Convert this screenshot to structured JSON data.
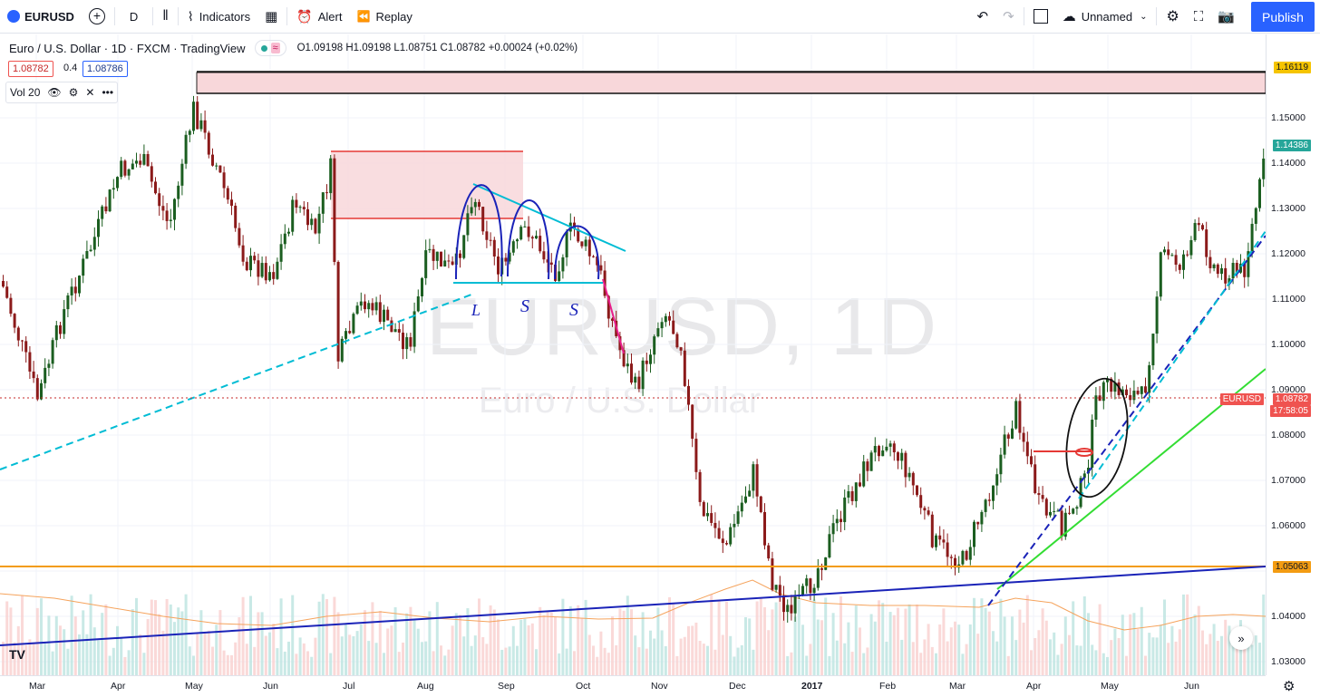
{
  "toolbar": {
    "symbol": "EURUSD",
    "interval": "D",
    "indicators_label": "Indicators",
    "alert_label": "Alert",
    "replay_label": "Replay",
    "layout_name": "Unnamed",
    "publish_label": "Publish"
  },
  "legend": {
    "title": "Euro / U.S. Dollar · 1D · FXCM · TradingView",
    "ohlc": "O1.09198 H1.09198 L1.08751 C1.08782 +0.00024 (+0.02%)",
    "bid": "1.08782",
    "spread": "0.4",
    "ask": "1.08786",
    "vol_label": "Vol 20"
  },
  "watermark": {
    "symbol": "EURUSD, 1D",
    "name": "Euro / U.S. Dollar"
  },
  "price_axis": {
    "ticks": [
      "1.15000",
      "1.14000",
      "1.13000",
      "1.12000",
      "1.11000",
      "1.10000",
      "1.09000",
      "1.08000",
      "1.07000",
      "1.06000",
      "1.05000",
      "1.04000",
      "1.03000"
    ],
    "tag_top": "1.16119",
    "tag_current": "1.14386",
    "tag_symbol": "EURUSD",
    "tag_price": "1.08782",
    "tag_countdown": "17:58:05",
    "tag_support": "1.05063"
  },
  "time_axis": [
    "Mar",
    "Apr",
    "May",
    "Jun",
    "Jul",
    "Aug",
    "Sep",
    "Oct",
    "Nov",
    "Dec",
    "2017",
    "Feb",
    "Mar",
    "Apr",
    "May",
    "Jun"
  ],
  "annotations": {
    "l": "L",
    "s1": "S",
    "s2": "S"
  },
  "colors": {
    "up": "#26a69a",
    "down": "#ef5350",
    "candle_up": "#1b5e20",
    "candle_down": "#8b1a1a",
    "zone_fill": "#f8d7da",
    "accent": "#2962ff",
    "cyan": "#00bcd4",
    "orange": "#f39c12"
  }
}
